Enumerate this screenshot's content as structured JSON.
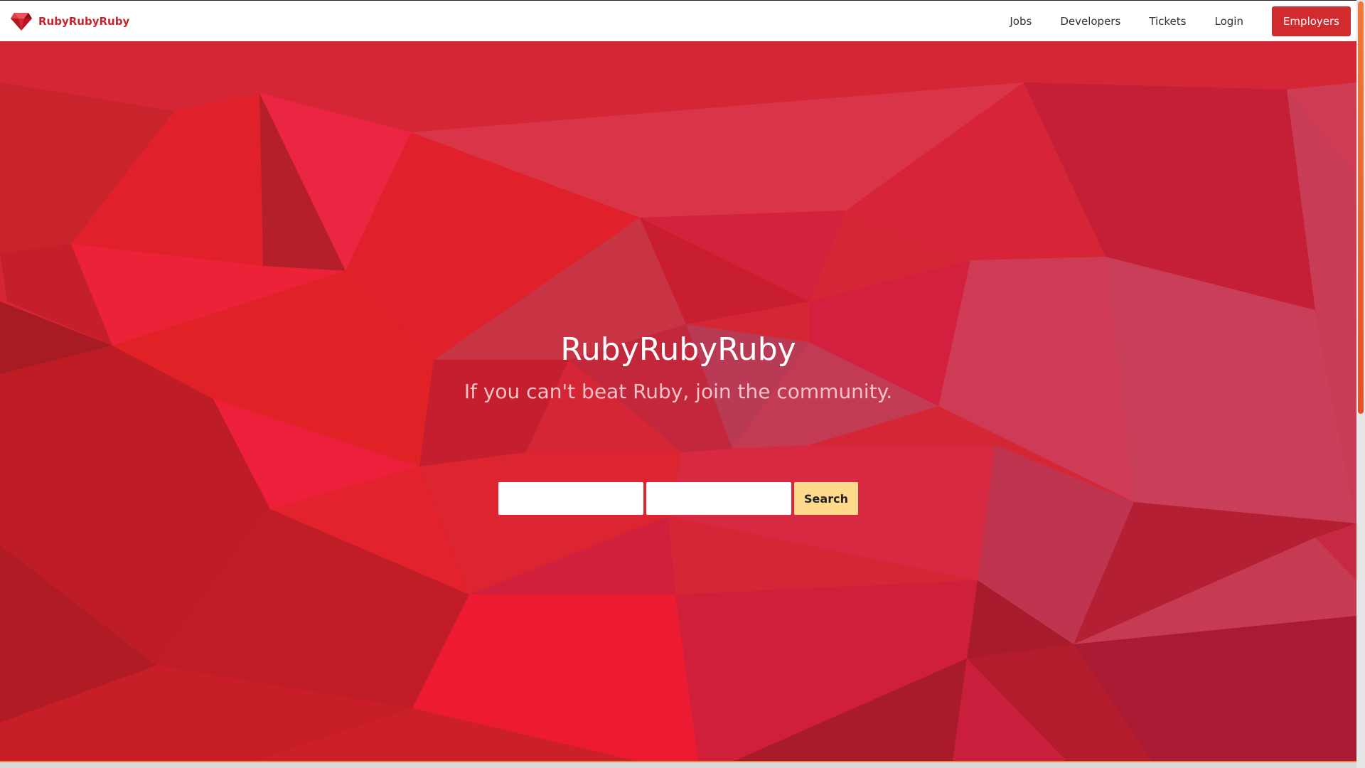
{
  "header": {
    "brand_name": "RubyRubyRuby",
    "brand_icon": "ruby-gem-icon",
    "nav": {
      "jobs": "Jobs",
      "developers": "Developers",
      "tickets": "Tickets",
      "login": "Login",
      "employers": "Employers"
    }
  },
  "hero": {
    "title": "RubyRubyRuby",
    "subtitle": "If you can't beat Ruby, join the community.",
    "search": {
      "field_1_value": "",
      "field_2_value": "",
      "button_label": "Search"
    }
  },
  "colors": {
    "brand_red": "#c4262d",
    "cta_red": "#d22b2f",
    "hero_base": "#d52636",
    "search_button": "#ffd98c",
    "scroll_thumb": "#f07a3a"
  }
}
